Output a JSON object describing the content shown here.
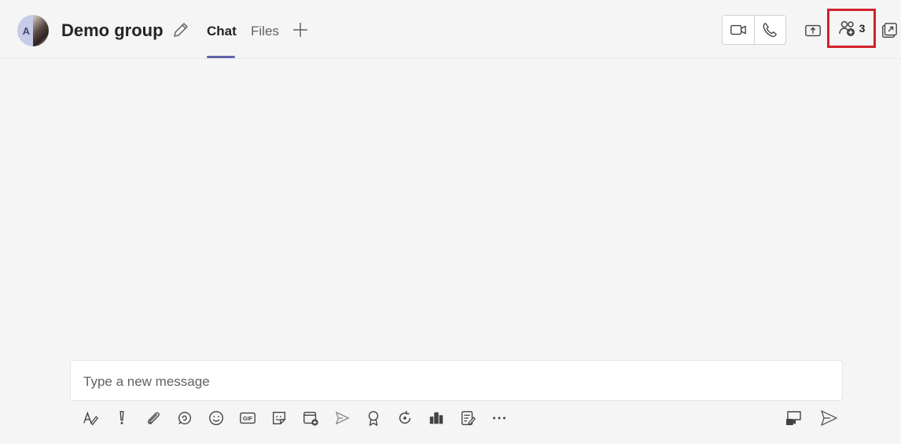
{
  "header": {
    "avatar_initial": "A",
    "group_name": "Demo group",
    "tabs": [
      {
        "label": "Chat",
        "active": true
      },
      {
        "label": "Files",
        "active": false
      }
    ],
    "participant_count": "3",
    "accent_color": "#6264a7",
    "highlight_color": "#d1222c"
  },
  "composer": {
    "placeholder": "Type a new message"
  },
  "toolbar_icons": [
    "format-icon",
    "important-icon",
    "attach-icon",
    "loop-icon",
    "emoji-icon",
    "gif-icon",
    "sticker-icon",
    "schedule-meeting-icon",
    "stream-icon",
    "praise-icon",
    "updates-icon",
    "approvals-icon",
    "forms-icon",
    "more-options-icon"
  ],
  "right_icons": [
    "meet-now-icon",
    "send-icon"
  ]
}
